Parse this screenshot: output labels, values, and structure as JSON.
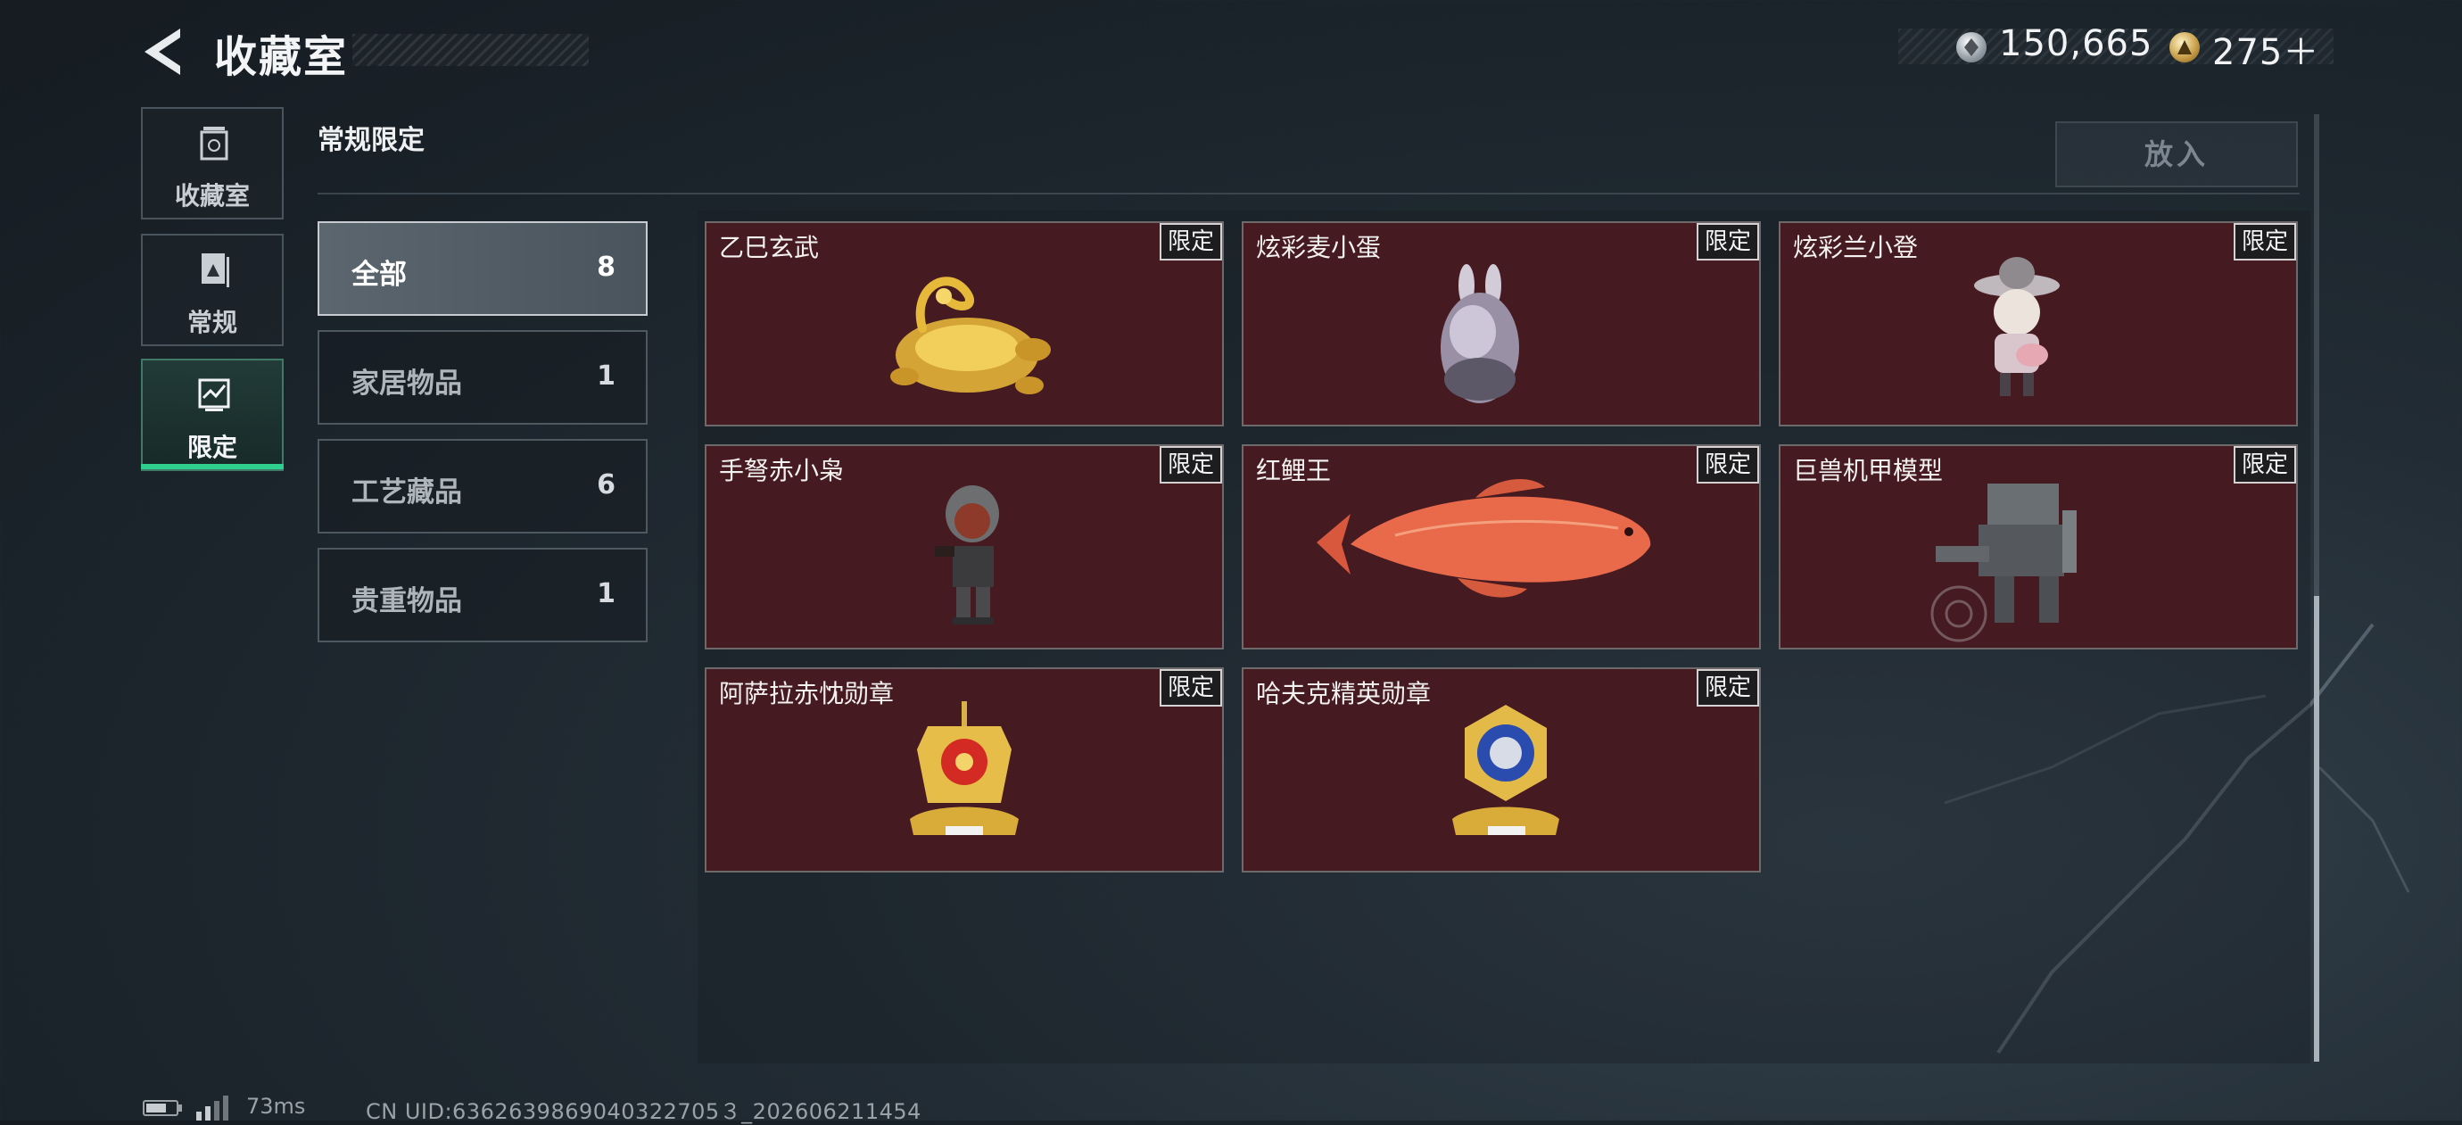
{
  "header": {
    "title": "收藏室",
    "currency_silver": "150,665",
    "currency_gold": "275＋"
  },
  "rail": {
    "items": [
      {
        "label": "收藏室",
        "icon": "trash-bin-icon"
      },
      {
        "label": "常规",
        "icon": "document-icon"
      },
      {
        "label": "限定",
        "icon": "limited-icon"
      }
    ]
  },
  "section_title": "常规限定",
  "place_button": "放入",
  "categories": [
    {
      "label": "全部",
      "count": "8"
    },
    {
      "label": "家居物品",
      "count": "1"
    },
    {
      "label": "工艺藏品",
      "count": "6"
    },
    {
      "label": "贵重物品",
      "count": "1"
    }
  ],
  "items": [
    {
      "name": "乙巳玄武",
      "badge": "限定",
      "icon": "golden-tortoise-snake-icon"
    },
    {
      "name": "炫彩麦小蛋",
      "badge": "限定",
      "icon": "rabbit-egg-figurine-icon"
    },
    {
      "name": "炫彩兰小登",
      "badge": "限定",
      "icon": "sombrero-figurine-icon"
    },
    {
      "name": "手弩赤小枭",
      "badge": "限定",
      "icon": "hooded-figure-icon"
    },
    {
      "name": "红鲤王",
      "badge": "限定",
      "icon": "red-carp-icon"
    },
    {
      "name": "巨兽机甲模型",
      "badge": "限定",
      "icon": "mech-model-icon"
    },
    {
      "name": "阿萨拉赤忱勋章",
      "badge": "限定",
      "icon": "red-medal-icon"
    },
    {
      "name": "哈夫克精英勋章",
      "badge": "限定",
      "icon": "blue-medal-icon"
    }
  ],
  "footer": {
    "ping": "73ms",
    "uid": "CN UID:6362639869040322705３_202606211454"
  },
  "colors": {
    "accent_green": "#2fd08e",
    "card_background": "#451a20"
  }
}
